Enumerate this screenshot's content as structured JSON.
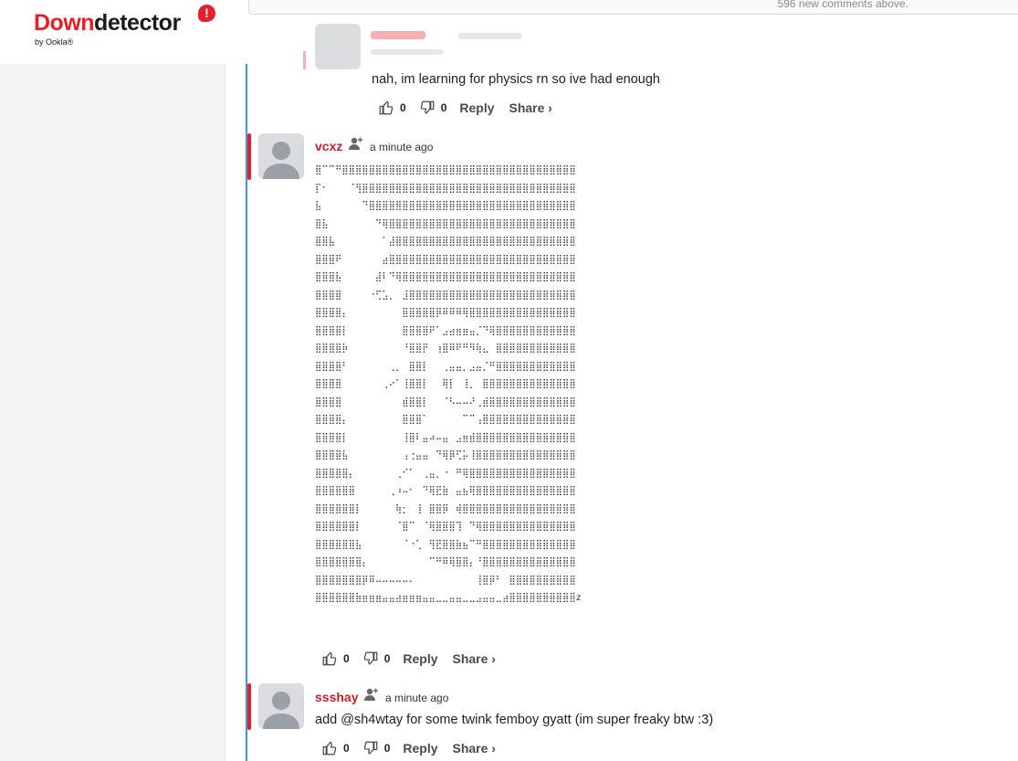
{
  "logo": {
    "word_down": "Down",
    "word_detector": "detector",
    "mark": "!",
    "sub": "by Ookla®"
  },
  "header": {
    "new_comments": "596 new comments above."
  },
  "comments": [
    {
      "id": "c1",
      "text": "nah, im learning for physics rn so ive had enough",
      "likes": "0",
      "dislikes": "0",
      "reply_label": "Reply",
      "share_label": "Share ›"
    },
    {
      "id": "c2",
      "username": "vcxz",
      "timestamp": "a minute ago",
      "ascii_rows": [
        "⣿⠉⠉⠛⣿⣿⣿⣿⣿⣿⣿⣿⣿⣿⣿⣿⣿⣿⣿⣿⣿⣿⣿⣿⣿⣿⣿⣿⣿⣿⣿⣿⣿⣿⣿⣿⣿⣿⣿",
        "⡏⠂⠀⠀⠀⠈⢻⣿⣿⣿⣿⣿⣿⣿⣿⣿⣿⣿⣿⣿⣿⣿⣿⣿⣿⣿⣿⣿⣿⣿⣿⣿⣿⣿⣿⣿⣿⣿⣿",
        "⣧⠀⠀⠀⠀⠀⠀⠙⣿⣿⣿⣿⣿⣿⣿⣿⣿⣿⣿⣿⣿⣿⣿⣿⣿⣿⣿⣿⣿⣿⣿⣿⣿⣿⣿⣿⣿⣿⣿",
        "⣿⣧⠀⠀⠀⠀⠀⠀⠀⠙⢿⣿⣿⣿⣿⣿⣿⣿⣿⣿⣿⣿⣿⣿⣿⣿⣿⣿⣿⣿⣿⣿⣿⣿⣿⣿⣿⣿⣿",
        "⣿⣿⣧⠀⠀⠀⠀⠀⠀⠀⠁⣼⣿⣿⣿⣿⣿⣿⣿⣿⣿⣿⣿⣿⣿⣿⣿⣿⣿⣿⣿⣿⣿⣿⣿⣿⣿⣿⣿",
        "⣿⣿⣿⠟⠀⠀⠀⠀⠀⠀⣴⣿⣿⣿⣿⣿⣿⣿⣿⣿⣿⣿⣿⣿⣿⣿⣿⣿⣿⣿⣿⣿⣿⣿⣿⣿⣿⣿⣿",
        "⣿⣿⣿⣧⠀⠀⠀⠀⠀⣼⠇⠙⢿⣿⣿⣿⣿⣿⣿⣿⣿⣿⣿⣿⣿⣿⣿⣿⣿⣿⣿⣿⣿⣿⣿⣿⣿⣿⣿",
        "⣿⣿⣿⣿⠀⠀⠀⠀⠐⢋⣡⡀⠀⣸⣿⣿⣿⣿⣿⣿⣿⣿⣿⣿⣿⣿⣿⣿⣿⣿⣿⣿⣿⣿⣿⣿⣿⣿⣿",
        "⣿⣿⣿⣿⡄⠀⠀⠀⠀⠀⠀⠀⠀⣿⣿⣿⣿⣿⡿⠿⠿⠿⢿⣿⣿⣿⣿⣿⣿⣿⣿⣿⣿⣿⣿⣿⣿⣿⣿",
        "⣿⣿⣿⣿⡇⠀⠀⠀⠀⠀⠀⠀⠀⣿⣿⣿⣿⠟⠁⣠⣴⣶⣶⣤⡈⠙⢿⣿⣿⣿⣿⣿⣿⣿⣿⣿⣿⣿⣿",
        "⣿⣿⣿⣿⡷⠀⠀⠀⠀⠀⠀⠀⠀⠘⣿⣿⡟⠀⢰⣿⠿⠟⠛⠻⢷⣄⠀⣿⣿⣿⣿⣿⣿⣿⣿⣿⣿⣿⣿",
        "⣿⣿⣿⣿⠃⠀⠀⠀⠀⠀⠀⢀⡀⠀⣿⣿⡇⠀⠀⢀⣤⣤⡀⣠⣤⡈⠛⣿⣿⣿⣿⣿⣿⣿⣿⣿⣿⣿⣿",
        "⣿⣿⣿⣿⠀⠀⠀⠀⠀⠀⢀⠔⠁⢸⣿⣿⡇⠀⠀⢿⡇⠀⢸⡀⠀⣿⣿⣿⣿⣿⣿⣿⣿⣿⣿⣿⣿⣿⣿",
        "⣿⣿⣿⣿⠀⠀⠀⠀⠀⠀⠀⠀⠀⣾⣿⣿⡇⠀⠀⠈⠣⠤⠤⠜⢀⣾⣿⣿⣿⣿⣿⣿⣿⣿⣿⣿⣿⣿⣿",
        "⣿⣿⣿⣿⡄⠀⠀⠀⠀⠀⠀⠀⠀⣿⣿⣿⠁⠀⠀⠀⠀⠀⠉⠉⢠⣿⣿⣿⣿⣿⣿⣿⣿⣿⣿⣿⣿⣿⣿",
        "⣿⣿⣿⣿⡇⠀⠀⠀⠀⠀⠀⠀⠀⢸⣿⠇⣤⠴⠤⣤⠀⣠⣶⣾⣿⣿⣿⣿⣿⣿⣿⣿⣿⣿⣿⣿⣿⣿⣿",
        "⣿⣿⣿⣿⣧⠀⠀⠀⠀⠀⠀⠀⠀⢠⢐⣤⣤⠀⠙⢿⡿⢋⡥⢸⣿⣿⣿⣿⣿⣿⣿⣿⣿⣿⣿⣿⣿⣿⣿",
        "⣿⣿⣿⣿⣿⡄⠀⠀⠀⠀⠀⠀⢀⠊⠁⠀⢀⣤⡀⠐⠀⠛⢿⣿⣿⣿⣿⣿⣿⣿⣿⣿⣿⣿⣿⣿⣿⣿⣿",
        "⣿⣿⣿⣿⣿⣿⠀⠀⠀⠀⠀⢀⠰⠤⠂⠀⠙⢿⣟⣷⠀⣤⣦⢿⣿⣿⣿⣿⣿⣿⣿⣿⣿⣿⣿⣿⣿⣿⣿",
        "⣿⣿⣿⣿⣿⣿⡇⠀⠀⠀⠀⠀⢷⡂⠀⢸⠀⣿⣿⡿⠀⢾⣿⣿⣿⣿⣿⣿⣿⣿⣿⣿⣿⣿⣿⣿⣿⣿⣿",
        "⣿⣿⣿⣿⣿⣿⡇⠀⠀⠀⠀⠀⠈⣿⠉⠀⠈⢿⣿⣿⣿⢹⠀⠙⢿⣿⣿⣿⣿⣿⣿⣿⣿⣿⣿⣿⣿⣿⣿",
        "⣿⣿⣿⣿⣿⣿⣧⠀⠀⠀⠀⠀⠀⠈⠐⢁⠀⢻⣟⣿⣿⣷⣦⠉⠛⣿⣿⣿⣿⣿⣿⣿⣿⣿⣿⣿⣿⣿⣿",
        "⣿⣿⣿⣿⣿⣿⣿⡄⠀⠀⠀⠀⠀⠀⠀⠀⠀⠉⠛⠿⢿⣿⣿⡄⠘⣿⣿⣿⣿⣿⣿⣿⣿⣿⣿⣿⣿⣿⣿",
        "⣿⣿⣿⣿⣿⣿⣿⡿⠿⠤⠤⠤⠤⠤⠄⠀⠀⠀⠀⠀⠀⠀⠀⠀⢸⣿⡿⠃⠀⣿⣿⣿⣿⣿⣿⣿⣿⣿⣿",
        "⣿⣿⣿⣿⣿⣿⣷⣶⣶⣶⣤⣤⣴⣶⣶⣶⣤⣤⣀⣀⣤⣤⣀⣀⣠⣤⣤⣀⣴⣿⣿⣿⣿⣿⣿⣿⣿⣿⣿z"
      ],
      "likes": "0",
      "dislikes": "0",
      "reply_label": "Reply",
      "share_label": "Share ›"
    },
    {
      "id": "c3",
      "username": "ssshay",
      "timestamp": "a minute ago",
      "text": "add @sh4wtay for some twink femboy gyatt (im super freaky btw :3)",
      "likes": "0",
      "dislikes": "0",
      "reply_label": "Reply",
      "share_label": "Share ›"
    }
  ],
  "colors": {
    "brand_red": "#e5202a",
    "username_red": "#c9202a",
    "thread_line_blue": "#3a9ad9"
  },
  "icons": [
    "thumbs-up-icon",
    "thumbs-down-icon",
    "follow-user-icon",
    "avatar-placeholder-icon"
  ]
}
